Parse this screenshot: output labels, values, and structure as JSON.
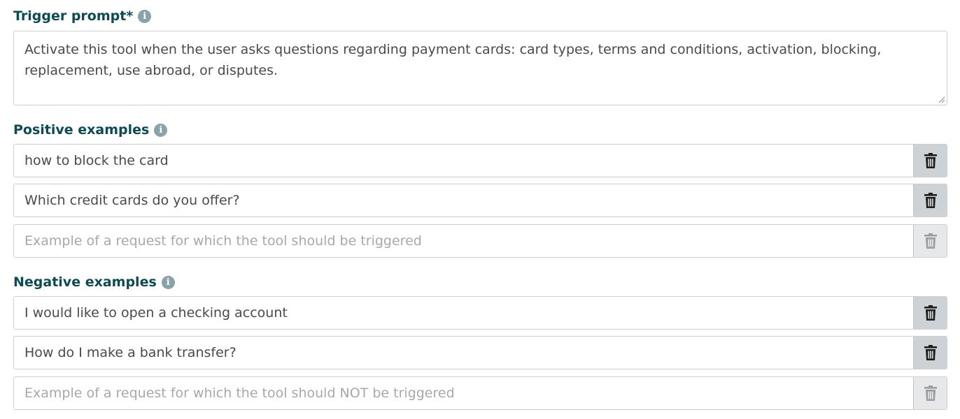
{
  "trigger": {
    "label": "Trigger prompt*",
    "value": "Activate this tool when the user asks questions regarding payment cards: card types, terms and conditions, activation, blocking, replacement, use abroad, or disputes."
  },
  "positive": {
    "label": "Positive examples",
    "items": [
      "how to block the card",
      "Which credit cards do you offer?"
    ],
    "placeholder": "Example of a request for which the tool should be triggered"
  },
  "negative": {
    "label": "Negative examples",
    "items": [
      "I would like to open a checking account",
      "How do I make a bank transfer?"
    ],
    "placeholder": "Example of a request for which the tool should NOT be triggered"
  },
  "icons": {
    "info": "info-icon",
    "delete": "trash-icon"
  },
  "colors": {
    "label": "#0d4a52",
    "info_icon": "#8aa3a8",
    "delete_bg": "#cdd2d6",
    "delete_bg_disabled": "#e6e8ea",
    "trash_active": "#1e1e1e",
    "trash_disabled": "#9a9ea2"
  }
}
